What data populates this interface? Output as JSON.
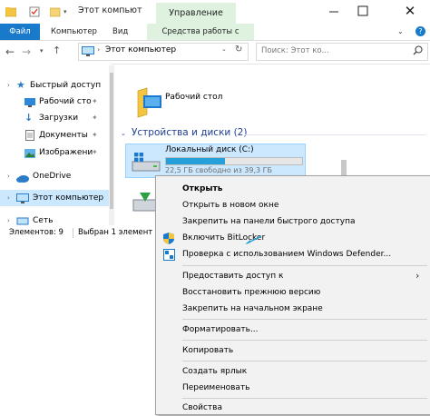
{
  "titlebar": {
    "title": "Этот компьют",
    "manage_tab": "Управление",
    "close_glyph": "✕"
  },
  "ribbon": {
    "file": "Файл",
    "computer": "Компьютер",
    "view": "Вид",
    "drive_tools": "Средства работы с дисками"
  },
  "address": {
    "path_segment": "Этот компьютер",
    "search_placeholder": "Поиск: Этот ко..."
  },
  "nav": {
    "items": [
      {
        "label": "Быстрый доступ",
        "icon": "star-icon"
      },
      {
        "label": "Рабочий сто",
        "icon": "desktop-icon",
        "pinned": true
      },
      {
        "label": "Загрузки",
        "icon": "download-icon",
        "pinned": true
      },
      {
        "label": "Документы",
        "icon": "documents-icon",
        "pinned": true
      },
      {
        "label": "Изображени",
        "icon": "pictures-icon",
        "pinned": true
      },
      {
        "label": "OneDrive",
        "icon": "cloud-icon"
      },
      {
        "label": "Этот компьютер",
        "icon": "computer-icon"
      },
      {
        "label": "Сеть",
        "icon": "network-icon"
      }
    ]
  },
  "content": {
    "desktop_folder": "Рабочий стол",
    "group_header": "Устройства и диски (2)",
    "drive_name": "Локальный диск (C:)",
    "drive_free": "22,5 ГБ свободно из 39,3 ГБ",
    "drive_used_fraction": 0.43
  },
  "status": {
    "elements": "Элементов: 9",
    "selected": "Выбран 1 элемент"
  },
  "context_menu": {
    "open": "Открыть",
    "open_new_window": "Открыть в новом окне",
    "pin_quick_access": "Закрепить на панели быстрого доступа",
    "bitlocker": "Включить BitLocker",
    "defender": "Проверка с использованием Windows Defender...",
    "share": "Предоставить доступ к",
    "restore": "Восстановить прежнюю версию",
    "pin_start": "Закрепить на начальном экране",
    "format": "Форматировать...",
    "copy": "Копировать",
    "shortcut": "Создать ярлык",
    "rename": "Переименовать",
    "properties": "Свойства"
  },
  "colors": {
    "accent": "#1979ca",
    "manage_tab_bg": "#dff2df",
    "selection": "#cce8ff",
    "drive_bar": "#26a0da"
  }
}
